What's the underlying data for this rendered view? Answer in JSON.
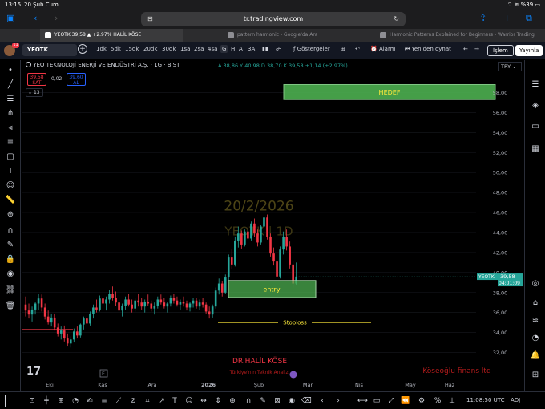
{
  "status_bar": {
    "time": "13:15",
    "date": "20 Şub Cum",
    "indicators": "⌔ ≋ %39 ▭"
  },
  "safari": {
    "url": "tr.tradingview.com",
    "aa_label": "⊟"
  },
  "browser_tabs": [
    {
      "label": "YEOTK 39,58 ▲ +2.97% HALİL KÖSE"
    },
    {
      "label": "pattern harmonic - Google'da Ara"
    },
    {
      "label": "Harmonic Patterns Explained for Beginners - Warrior Trading"
    }
  ],
  "toolbar": {
    "notification_count": "11",
    "symbol": "YEOTK",
    "timeframes": [
      "1dk",
      "5dk",
      "15dk",
      "20dk",
      "30dk",
      "1sa",
      "2sa",
      "4sa",
      "G",
      "H",
      "A",
      "3A"
    ],
    "active_timeframe": "G",
    "indicators_label": "Göstergeler",
    "alarm_label": "Alarm",
    "replay_label": "Yeniden oynat",
    "trade_label": "İşlem",
    "publish_label": "Yayınla"
  },
  "legend": {
    "title": "YEO TEKNOLOJİ ENERJİ VE ENDÜSTRİ A.Ş. · 1G · BIST",
    "ohlc": "A 38,86  Y 40,98  D 38,70  K 39,58  +1,14 (+2,97%)",
    "sell_price": "39,58",
    "sell_label": "SAT",
    "spread": "0,02",
    "buy_price": "39,60",
    "buy_label": "AL",
    "visibility_count": "13",
    "currency": "TRY"
  },
  "chart_data": {
    "type": "candlestick",
    "symbol": "YEOTK",
    "interval": "1G",
    "ylim": [
      31,
      59
    ],
    "y_ticks": [
      "58,00",
      "56,00",
      "54,00",
      "52,00",
      "50,00",
      "48,00",
      "46,00",
      "44,00",
      "42,00",
      "40,00",
      "38,00",
      "36,00",
      "34,00",
      "32,00"
    ],
    "x_ticks": [
      "Eki",
      "Kas",
      "Ara",
      "2026",
      "Şub",
      "Mar",
      "Nis",
      "May",
      "Haz"
    ],
    "last_price": {
      "symbol": "YEOTK",
      "value": "39,58",
      "countdown": "04:01:09"
    },
    "annotations": {
      "target_label": "HEDEF",
      "target_zone": [
        57.3,
        58.8
      ],
      "entry_label": "entry",
      "entry_zone": [
        37.5,
        39.2
      ],
      "stoploss_label": "Stoploss",
      "stoploss_level": 35.0,
      "watermark_date": "20/2/2026",
      "watermark_symbol": "YEOTK | 1D",
      "author": "DR.HALİL KÖSE",
      "author_subtitle": "Türkiye'nin Teknik Analizi",
      "company": "Köseoğlu finans ltd"
    },
    "candles_ohlc": [
      [
        36.8,
        37.6,
        35.6,
        36.2
      ],
      [
        36.2,
        36.9,
        35.4,
        35.8
      ],
      [
        35.8,
        36.6,
        35.1,
        36.3
      ],
      [
        36.3,
        37.1,
        35.8,
        36.9
      ],
      [
        36.9,
        37.9,
        36.3,
        37.4
      ],
      [
        37.4,
        37.8,
        36.1,
        36.5
      ],
      [
        36.5,
        36.9,
        35.3,
        35.6
      ],
      [
        35.6,
        36.2,
        34.8,
        35.0
      ],
      [
        35.0,
        35.9,
        34.6,
        35.5
      ],
      [
        35.5,
        35.9,
        34.2,
        34.5
      ],
      [
        34.5,
        34.9,
        33.6,
        33.9
      ],
      [
        33.9,
        34.6,
        33.3,
        34.2
      ],
      [
        34.2,
        34.7,
        33.1,
        33.4
      ],
      [
        33.4,
        33.9,
        32.6,
        32.9
      ],
      [
        32.9,
        33.6,
        32.5,
        33.3
      ],
      [
        33.3,
        34.4,
        33.0,
        34.1
      ],
      [
        34.1,
        34.6,
        33.4,
        33.7
      ],
      [
        33.7,
        34.9,
        33.5,
        34.8
      ],
      [
        34.8,
        35.6,
        34.3,
        35.4
      ],
      [
        35.4,
        35.8,
        34.6,
        34.9
      ],
      [
        34.9,
        36.1,
        34.7,
        35.9
      ],
      [
        35.9,
        36.8,
        35.4,
        36.5
      ],
      [
        36.5,
        37.3,
        36.0,
        36.3
      ],
      [
        36.3,
        37.7,
        36.1,
        37.4
      ],
      [
        37.4,
        38.0,
        36.6,
        36.9
      ],
      [
        36.9,
        37.6,
        36.2,
        37.3
      ],
      [
        37.3,
        38.3,
        36.9,
        37.9
      ],
      [
        37.9,
        38.6,
        37.2,
        37.5
      ],
      [
        37.5,
        38.1,
        36.7,
        37.0
      ],
      [
        37.0,
        37.4,
        35.9,
        36.2
      ],
      [
        36.2,
        36.9,
        35.6,
        36.7
      ],
      [
        36.7,
        37.6,
        36.3,
        37.3
      ],
      [
        37.3,
        37.9,
        36.6,
        36.8
      ],
      [
        36.8,
        37.3,
        36.0,
        36.4
      ],
      [
        36.4,
        37.4,
        36.1,
        37.2
      ],
      [
        37.2,
        37.9,
        36.6,
        37.0
      ],
      [
        37.0,
        37.5,
        36.3,
        36.6
      ],
      [
        36.6,
        37.3,
        36.0,
        37.1
      ],
      [
        37.1,
        37.8,
        36.7,
        36.9
      ],
      [
        36.9,
        37.2,
        36.1,
        36.4
      ],
      [
        36.4,
        37.0,
        35.8,
        36.7
      ],
      [
        36.7,
        37.6,
        36.4,
        37.3
      ],
      [
        37.3,
        37.8,
        36.8,
        37.0
      ],
      [
        37.0,
        37.5,
        36.4,
        36.6
      ],
      [
        36.6,
        37.1,
        36.0,
        36.9
      ],
      [
        36.9,
        37.7,
        36.6,
        37.5
      ],
      [
        37.5,
        37.9,
        36.9,
        37.2
      ],
      [
        37.2,
        37.6,
        36.6,
        36.8
      ],
      [
        36.8,
        37.3,
        36.3,
        37.1
      ],
      [
        37.1,
        37.6,
        36.6,
        36.9
      ],
      [
        36.9,
        37.2,
        36.2,
        36.5
      ],
      [
        36.5,
        37.1,
        36.1,
        36.9
      ],
      [
        36.9,
        37.5,
        36.5,
        37.2
      ],
      [
        37.2,
        37.5,
        36.4,
        36.6
      ],
      [
        36.6,
        37.3,
        36.3,
        37.0
      ],
      [
        37.0,
        37.5,
        36.5,
        36.8
      ],
      [
        36.8,
        37.0,
        35.9,
        36.1
      ],
      [
        36.1,
        36.6,
        35.4,
        35.8
      ],
      [
        35.8,
        36.8,
        35.5,
        36.6
      ],
      [
        36.6,
        38.5,
        36.4,
        38.2
      ],
      [
        38.2,
        39.4,
        37.8,
        38.9
      ],
      [
        38.9,
        39.1,
        37.6,
        38.0
      ],
      [
        38.0,
        39.8,
        37.9,
        39.5
      ],
      [
        39.5,
        41.8,
        39.2,
        41.5
      ],
      [
        41.5,
        42.3,
        40.3,
        40.8
      ],
      [
        40.8,
        43.6,
        40.6,
        43.2
      ],
      [
        43.2,
        44.6,
        42.5,
        43.9
      ],
      [
        43.9,
        44.2,
        42.4,
        42.8
      ],
      [
        42.8,
        44.3,
        42.6,
        44.1
      ],
      [
        44.1,
        44.6,
        43.1,
        43.4
      ],
      [
        43.4,
        45.1,
        43.2,
        44.9
      ],
      [
        44.9,
        45.4,
        43.6,
        43.9
      ],
      [
        43.9,
        44.3,
        42.6,
        43.0
      ],
      [
        43.0,
        44.8,
        42.8,
        44.6
      ],
      [
        44.6,
        46.8,
        44.3,
        45.5
      ],
      [
        45.5,
        45.8,
        43.3,
        43.6
      ],
      [
        43.6,
        43.9,
        41.6,
        41.9
      ],
      [
        41.9,
        42.5,
        40.7,
        41.1
      ],
      [
        41.1,
        41.4,
        39.2,
        39.6
      ],
      [
        39.6,
        42.6,
        39.4,
        42.3
      ],
      [
        42.3,
        44.1,
        41.8,
        43.6
      ],
      [
        43.6,
        44.3,
        42.2,
        42.6
      ],
      [
        42.6,
        43.1,
        40.4,
        40.8
      ],
      [
        40.8,
        41.2,
        38.5,
        38.9
      ],
      [
        38.9,
        41.0,
        38.7,
        39.6
      ]
    ]
  },
  "bottom_toolbar": {
    "clock": "11:08:50 UTC",
    "adjust_label": "ADJ"
  }
}
